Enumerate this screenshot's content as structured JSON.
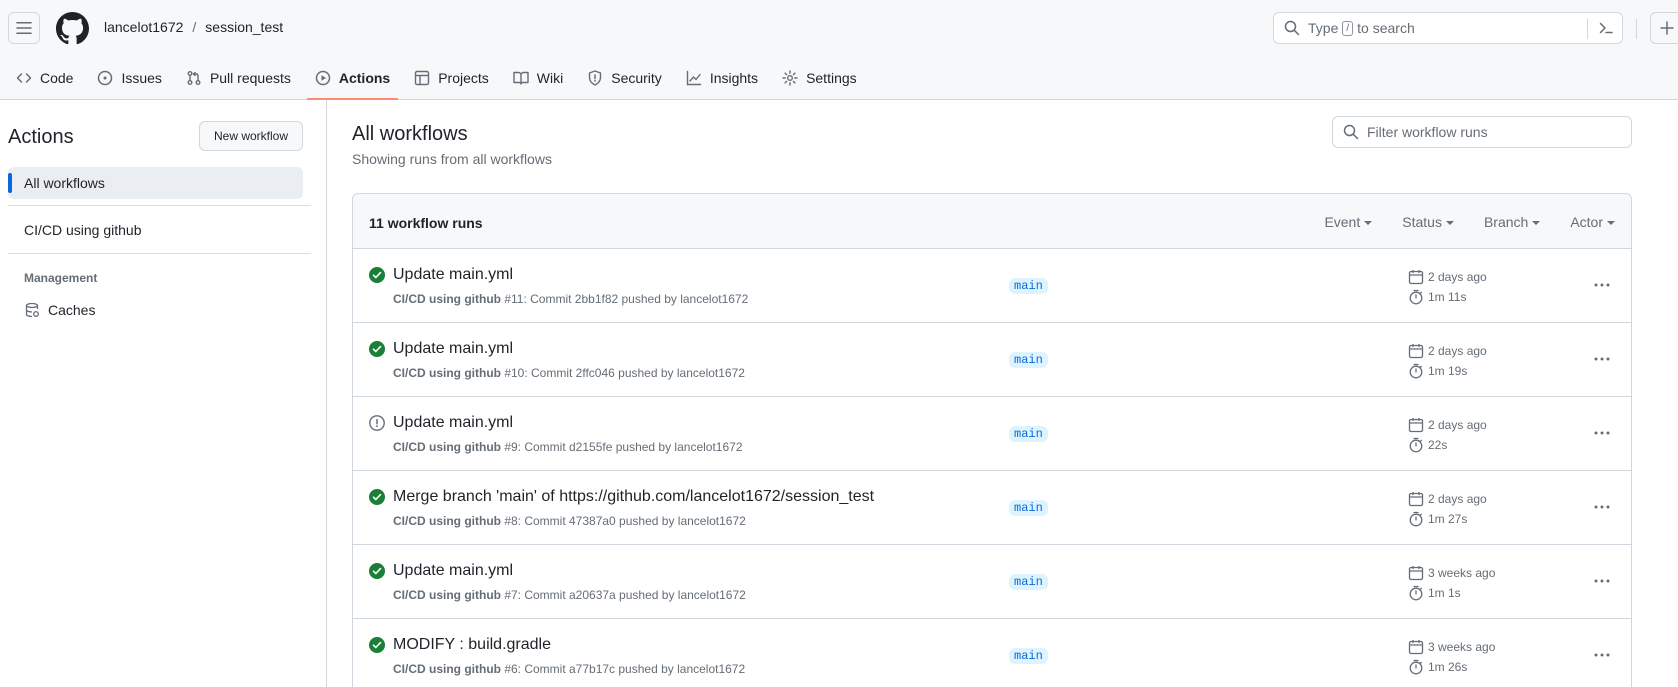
{
  "colors": {
    "success": "#1a7f37",
    "neutral": "#656d76",
    "accent": "#0969da",
    "tab_underline": "#fd8c73"
  },
  "header": {
    "owner": "lancelot1672",
    "separator": "/",
    "repo": "session_test",
    "search_prefix": "Type",
    "search_key": "/",
    "search_suffix": "to search"
  },
  "tabs": [
    {
      "label": "Code",
      "icon": "code-icon"
    },
    {
      "label": "Issues",
      "icon": "issue-icon"
    },
    {
      "label": "Pull requests",
      "icon": "pull-request-icon"
    },
    {
      "label": "Actions",
      "icon": "play-icon",
      "active": true
    },
    {
      "label": "Projects",
      "icon": "table-icon"
    },
    {
      "label": "Wiki",
      "icon": "book-icon"
    },
    {
      "label": "Security",
      "icon": "shield-icon"
    },
    {
      "label": "Insights",
      "icon": "graph-icon"
    },
    {
      "label": "Settings",
      "icon": "gear-icon"
    }
  ],
  "sidebar": {
    "title": "Actions",
    "new_workflow": "New workflow",
    "items": [
      {
        "label": "All workflows",
        "active": true
      },
      {
        "label": "CI/CD using github"
      }
    ],
    "group_label": "Management",
    "caches": "Caches"
  },
  "main": {
    "title": "All workflows",
    "subtitle": "Showing runs from all workflows",
    "filter_placeholder": "Filter workflow runs",
    "runs_count": "11 workflow runs",
    "filters": [
      "Event",
      "Status",
      "Branch",
      "Actor"
    ],
    "runs": [
      {
        "status": "success",
        "title": "Update main.yml",
        "workflow": "CI/CD using github",
        "detail": "#11: Commit 2bb1f82 pushed by lancelot1672",
        "branch": "main",
        "when": "2 days ago",
        "duration": "1m 11s"
      },
      {
        "status": "success",
        "title": "Update main.yml",
        "workflow": "CI/CD using github",
        "detail": "#10: Commit 2ffc046 pushed by lancelot1672",
        "branch": "main",
        "when": "2 days ago",
        "duration": "1m 19s"
      },
      {
        "status": "neutral",
        "title": "Update main.yml",
        "workflow": "CI/CD using github",
        "detail": "#9: Commit d2155fe pushed by lancelot1672",
        "branch": "main",
        "when": "2 days ago",
        "duration": "22s"
      },
      {
        "status": "success",
        "title": "Merge branch 'main' of https://github.com/lancelot1672/session_test",
        "workflow": "CI/CD using github",
        "detail": "#8: Commit 47387a0 pushed by lancelot1672",
        "branch": "main",
        "when": "2 days ago",
        "duration": "1m 27s"
      },
      {
        "status": "success",
        "title": "Update main.yml",
        "workflow": "CI/CD using github",
        "detail": "#7: Commit a20637a pushed by lancelot1672",
        "branch": "main",
        "when": "3 weeks ago",
        "duration": "1m 1s"
      },
      {
        "status": "success",
        "title": "MODIFY : build.gradle",
        "workflow": "CI/CD using github",
        "detail": "#6: Commit a77b17c pushed by lancelot1672",
        "branch": "main",
        "when": "3 weeks ago",
        "duration": "1m 26s"
      }
    ]
  }
}
